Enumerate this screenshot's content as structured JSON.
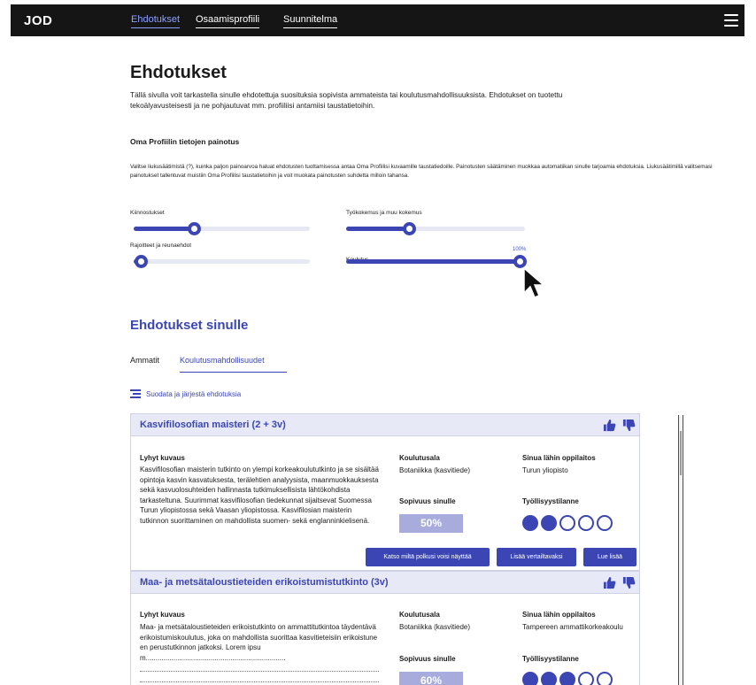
{
  "app": {
    "logo": "JOD"
  },
  "nav": {
    "items": [
      "Ehdotukset",
      "Osaamisprofiili",
      "Suunnitelma"
    ]
  },
  "page": {
    "title": "Ehdotukset",
    "intro": "Tällä sivulla voit tarkastella sinulle ehdotettuja suosituksia sopivista ammateista tai koulutusmahdollisuuksista. Ehdotukset on tuotettu tekoälyavusteisesti ja ne pohjautuvat mm. profiiliisi antamiisi taustatietoihin."
  },
  "weights": {
    "title": "Oma Profiilin tietojen painotus",
    "description": "Valitse liukusäätimistä (?), kuinka paljon painoarvoa haluat ehdotusten tuottamisessa antaa Oma Profiilisi kuvaamille taustatiedoille. Painotusten säätäminen muokkaa automatiikan sinulle tarjoamia ehdotuksia. Liukusäätimillä valitsemasi painotukset tallentuvat muistiin Oma Profiilisi taustatietoihin ja voit muokata painotusten suhdetta milloin tahansa.",
    "sliders": [
      {
        "label": "Kiinnostukset",
        "value": 0.34
      },
      {
        "label": "Työkokemus ja muu kokemus",
        "value": 0.35
      },
      {
        "label": "Rajoitteet ja reunaehdot",
        "value": 0.04
      },
      {
        "label": "Koulutus",
        "value": 1.0,
        "value_label": "100%"
      }
    ]
  },
  "suggestions": {
    "title": "Ehdotukset sinulle",
    "tabs": [
      "Ammatit",
      "Koulutusmahdollisuudet"
    ],
    "filter_label": "Suodata ja järjestä ehdotuksia",
    "cards": [
      {
        "title": "Kasvifilosofian maisteri (2 + 3v)",
        "short_desc_heading": "Lyhyt kuvaus",
        "short_desc": "Kasvifilosofian maisterin tutkinto on ylempi korkeakoulututkinto ja se sisältää opintoja kasvin kasvatuksesta, terälehtien analyysista, maanmuokkauksesta sekä kasvuolosuhteiden hallinnasta tutkimuksellisista lähtökohdista tarkasteltuna. Suurimmat kasvifilosofian tiedekunnat sijaitsevat Suomessa Turun yliopistossa sekä Vaasan yliopistossa. Kasvifilosian maisterin tutkinnon suorittaminen on mahdollista suomen- sekä englanninkielisenä.",
        "field_heading": "Koulutusala",
        "field": "Botaniikka (kasvitiede)",
        "institution_heading": "Sinua lähin oppilaitos",
        "institution": "Turun yliopisto",
        "fit_heading": "Sopivuus sinulle",
        "fit": "50%",
        "employment_heading": "Työllisyystilanne",
        "employment_level": 2,
        "employment_max": 5,
        "buttons": [
          "Katso miltä polkusi voisi näyttää",
          "Lisää vertailtavaksi",
          "Lue lisää"
        ]
      },
      {
        "title": "Maa- ja metsätaloustieteiden erikoistumistutkinto (3v)",
        "short_desc_heading": "Lyhyt kuvaus",
        "short_desc": "Maa- ja metsätaloustieteiden erikoistutkinto on ammattitutkintoa täydentävä erikoistumiskoulutus, joka on mahdollista suorittaa kasvitieteisiin erikoistuneen perustutkinnon jatkoksi. Lorem ipsum.......................................................................",
        "field_heading": "Koulutusala",
        "field": "Botaniikka (kasvitiede)",
        "institution_heading": "Sinua lähin oppilaitos",
        "institution": "Tampereen ammattikorkeakoulu",
        "fit_heading": "Sopivuus sinulle",
        "fit": "60%",
        "employment_heading": "Työllisyystilanne",
        "employment_level": 3,
        "employment_max": 5
      }
    ]
  },
  "colors": {
    "accent": "#3b45b3",
    "header_bg": "#151515",
    "card_head_bg": "#e7e9f6",
    "badge": "#a7acdc"
  },
  "icons": [
    "menu-icon",
    "filter-icon",
    "thumbs-up-icon",
    "thumbs-down-icon",
    "cursor-icon"
  ]
}
